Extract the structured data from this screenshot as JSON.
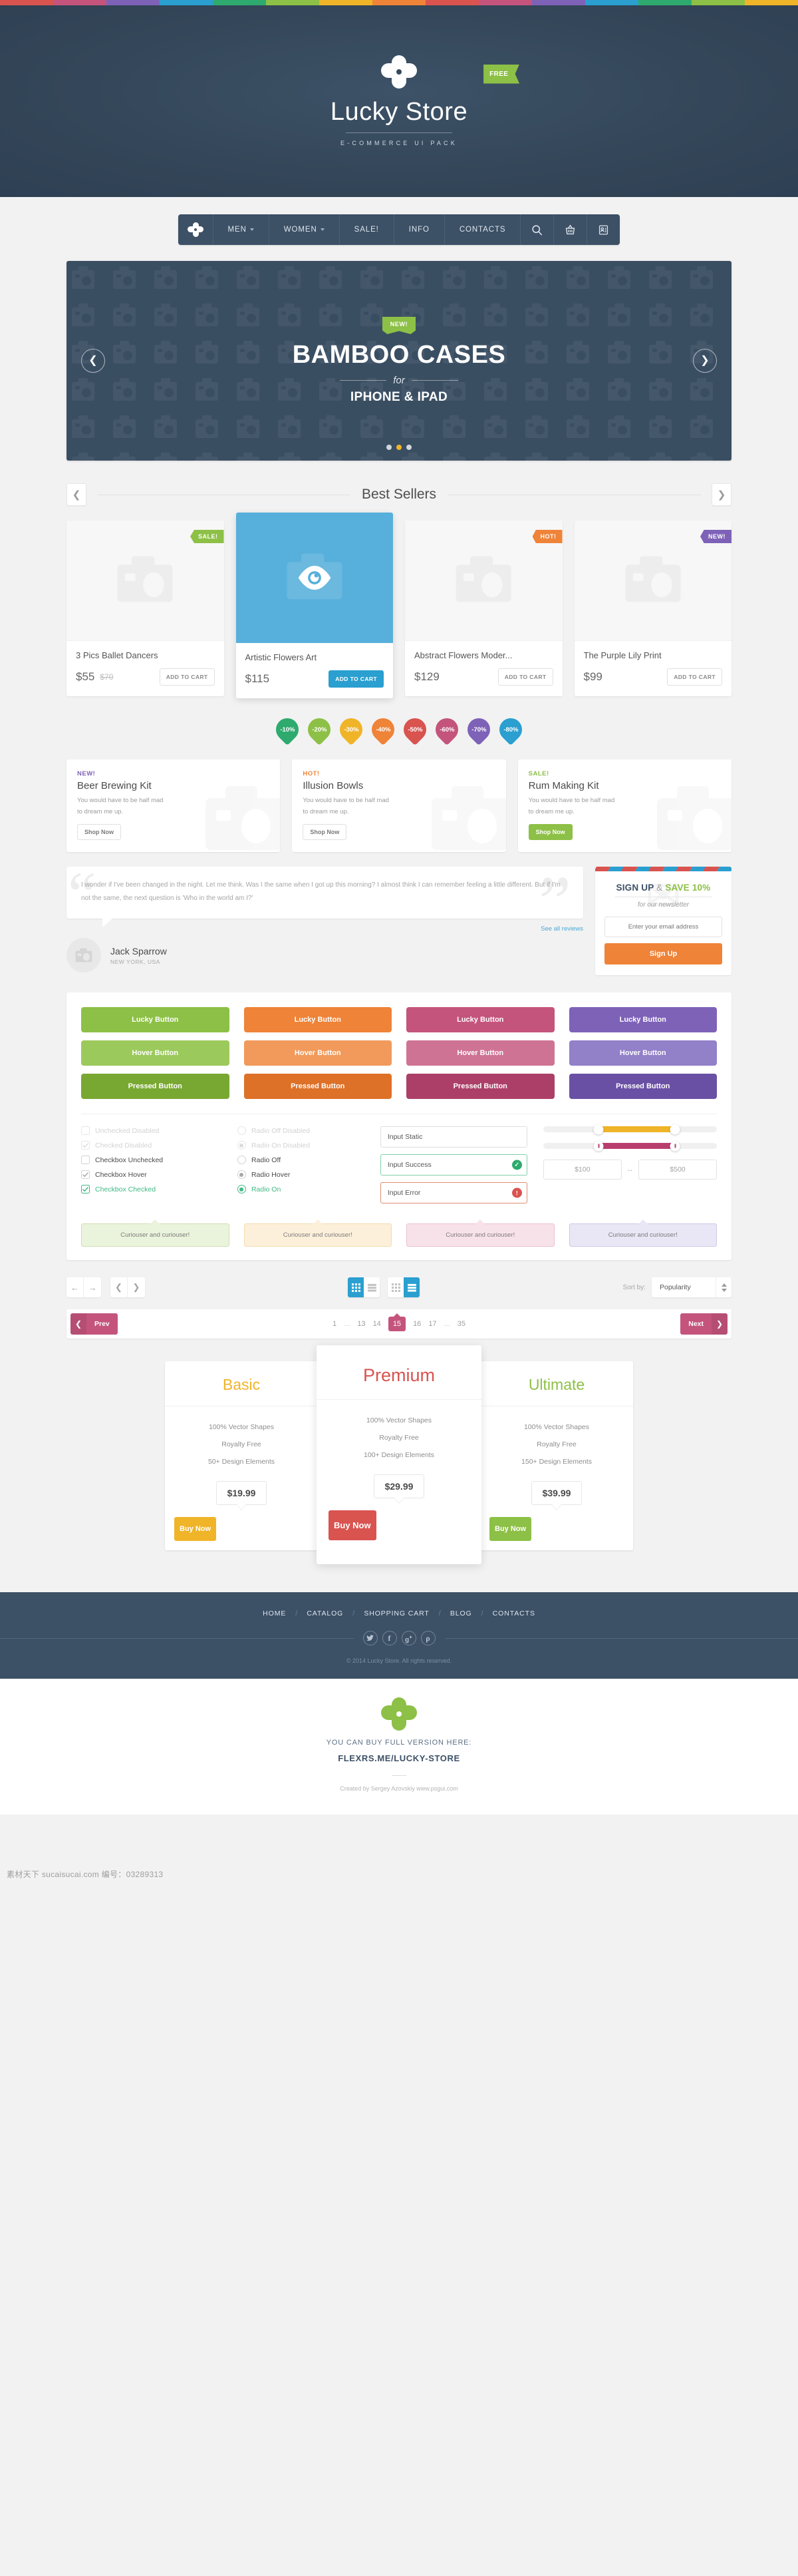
{
  "stripe_colors": [
    "#d9534f",
    "#c4547c",
    "#7e62b8",
    "#2a9fd0",
    "#2eaa6e",
    "#8dc046",
    "#f0b429",
    "#ef8338",
    "#d9534f",
    "#c4547c",
    "#7e62b8",
    "#2a9fd0",
    "#2eaa6e",
    "#8dc046",
    "#f0b429"
  ],
  "hero": {
    "logo_icon": "clover-logo-icon",
    "title": "Lucky Store",
    "subtitle": "E-COMMERCE UI PACK",
    "free_badge": "FREE"
  },
  "nav": {
    "logo_icon": "clover-logo-icon",
    "items": [
      {
        "label": "MEN",
        "has_caret": true
      },
      {
        "label": "WOMEN",
        "has_caret": true
      },
      {
        "label": "SALE!",
        "has_caret": false
      },
      {
        "label": "INFO",
        "has_caret": false
      },
      {
        "label": "CONTACTS",
        "has_caret": false
      }
    ],
    "icons": [
      "search-icon",
      "basket-icon",
      "contact-card-icon"
    ]
  },
  "slider": {
    "badge": "NEW!",
    "title": "BAMBOO CASES",
    "connector": "for",
    "subtitle": "IPHONE & IPAD",
    "prev_icon": "chevron-left-icon",
    "next_icon": "chevron-right-icon",
    "dots": 3,
    "active_dot": 2,
    "active_dot_color": "#f0b429"
  },
  "best_sellers": {
    "title": "Best Sellers",
    "prev_icon": "chevron-left-icon",
    "next_icon": "chevron-right-icon",
    "products": [
      {
        "name": "3 Pics Ballet Dancers",
        "price": "$55",
        "old_price": "$70",
        "cta": "ADD TO CART",
        "ribbon": "SALE!",
        "ribbon_color": "#8dc046",
        "featured": false
      },
      {
        "name": "Artistic Flowers Art",
        "price": "$115",
        "old_price": "",
        "cta": "ADD TO CART",
        "ribbon": "",
        "ribbon_color": "",
        "featured": true
      },
      {
        "name": "Abstract Flowers Moder...",
        "price": "$129",
        "old_price": "",
        "cta": "ADD TO CART",
        "ribbon": "HOT!",
        "ribbon_color": "#ef8338",
        "featured": false
      },
      {
        "name": "The Purple Lily Print",
        "price": "$99",
        "old_price": "",
        "cta": "ADD TO CART",
        "ribbon": "NEW!",
        "ribbon_color": "#7e62b8",
        "featured": false
      }
    ]
  },
  "discount_badges": [
    {
      "label": "-10%",
      "color": "#2eaa6e"
    },
    {
      "label": "-20%",
      "color": "#8dc046"
    },
    {
      "label": "-30%",
      "color": "#f0b429"
    },
    {
      "label": "-40%",
      "color": "#ef8338"
    },
    {
      "label": "-50%",
      "color": "#d9534f"
    },
    {
      "label": "-60%",
      "color": "#c4547c"
    },
    {
      "label": "-70%",
      "color": "#7e62b8"
    },
    {
      "label": "-80%",
      "color": "#2a9fd0"
    }
  ],
  "promos": [
    {
      "tag": "NEW!",
      "tag_color": "#7e62b8",
      "title": "Beer Brewing Kit",
      "text": "You would have to be half mad to dream me up.",
      "cta": "Shop Now",
      "cta_filled": false
    },
    {
      "tag": "HOT!",
      "tag_color": "#ef8338",
      "title": "Illusion Bowls",
      "text": "You would have to be half mad to dream me up.",
      "cta": "Shop Now",
      "cta_filled": false
    },
    {
      "tag": "SALE!",
      "tag_color": "#8dc046",
      "title": "Rum Making Kit",
      "text": "You would have to be half mad to dream me up.",
      "cta": "Shop Now",
      "cta_filled": true
    }
  ],
  "testimonial": {
    "quote": "I wonder if I've been changed in the night. Let me think. Was I the same when I got up this morning? I almost think I can remember feeling a little different. But if I'm not the same, the next question is 'Who in the world am I?'",
    "see_all": "See all reviews",
    "author_name": "Jack Sparrow",
    "author_location": "NEW YORK, USA",
    "avatar_icon": "photo-placeholder-icon"
  },
  "newsletter": {
    "title_1": "SIGN UP",
    "title_amp": "&",
    "title_2": "SAVE 10%",
    "tagline": "for our newsletter",
    "input_placeholder": "Enter your email address",
    "input_value": "",
    "button": "Sign Up",
    "button_color": "#ef8338",
    "edge_colors": [
      "#d9534f",
      "#2a9fd0",
      "#d9534f",
      "#2a9fd0",
      "#d9534f",
      "#2a9fd0",
      "#d9534f",
      "#2a9fd0",
      "#d9534f",
      "#2a9fd0"
    ]
  },
  "uikit": {
    "buttons": [
      {
        "label": "Lucky Button",
        "color": "#8dc046"
      },
      {
        "label": "Lucky Button",
        "color": "#ef8338"
      },
      {
        "label": "Lucky Button",
        "color": "#c4547c"
      },
      {
        "label": "Lucky Button",
        "color": "#7e62b8"
      },
      {
        "label": "Hover Button",
        "color": "#9cc95c"
      },
      {
        "label": "Hover Button",
        "color": "#f19a5c"
      },
      {
        "label": "Hover Button",
        "color": "#cf7394"
      },
      {
        "label": "Hover Button",
        "color": "#9280c9"
      },
      {
        "label": "Pressed Button",
        "color": "#79a832"
      },
      {
        "label": "Pressed Button",
        "color": "#dd7128"
      },
      {
        "label": "Pressed Button",
        "color": "#ac3f68"
      },
      {
        "label": "Pressed Button",
        "color": "#6a50a5"
      }
    ],
    "checkboxes": [
      {
        "label": "Unchecked Disabled",
        "state": "disabled-off"
      },
      {
        "label": "Checked Disabled",
        "state": "disabled-on"
      },
      {
        "label": "Checkbox Unchecked",
        "state": "off"
      },
      {
        "label": "Checkbox Hover",
        "state": "hover-on"
      },
      {
        "label": "Checkbox Checked",
        "state": "checked"
      }
    ],
    "radios": [
      {
        "label": "Radio Off Disabled",
        "state": "disabled-off"
      },
      {
        "label": "Radio On Disabled",
        "state": "disabled-on"
      },
      {
        "label": "Radio Off",
        "state": "off"
      },
      {
        "label": "Radio Hover",
        "state": "hover-on"
      },
      {
        "label": "Radio On",
        "state": "checked"
      }
    ],
    "inputs": [
      {
        "value": "Input Static",
        "state": "static",
        "icon": ""
      },
      {
        "value": "Input Success",
        "state": "success",
        "icon": "check-circle-icon"
      },
      {
        "value": "Input Error",
        "state": "error",
        "icon": "alert-circle-icon"
      }
    ],
    "sliders": [
      {
        "fill_color": "#f0b429",
        "start_pct": 32,
        "end_pct": 76,
        "style": "plain"
      },
      {
        "fill_color": "#b93d6e",
        "start_pct": 32,
        "end_pct": 76,
        "style": "lined"
      }
    ],
    "price_range": {
      "min": "$100",
      "max": "$500",
      "separator": "↔"
    },
    "tooltips": [
      {
        "label": "Curiouser and curiouser!",
        "bg": "#eaf3db",
        "border": "#cfe0b4"
      },
      {
        "label": "Curiouser and curiouser!",
        "bg": "#fdf0da",
        "border": "#f3dcae"
      },
      {
        "label": "Curiouser and curiouser!",
        "bg": "#f8e2ea",
        "border": "#ebc1ce"
      },
      {
        "label": "Curiouser and curiouser!",
        "bg": "#e9e6f5",
        "border": "#cfc8e6"
      }
    ]
  },
  "toolbar": {
    "nav_icons": [
      "arrow-left-icon",
      "arrow-right-icon"
    ],
    "chev_icons": [
      "chevron-left-icon",
      "chevron-right-icon"
    ],
    "view_sets": [
      {
        "icons": [
          "grid-view-icon",
          "list-view-icon"
        ],
        "active_index": 0
      },
      {
        "icons": [
          "grid-view-icon",
          "list-view-icon"
        ],
        "active_index": 1
      }
    ],
    "sort_label": "Sort by:",
    "sort_value": "Popularity",
    "accent": "#2a9fd0"
  },
  "pagination": {
    "prev": "Prev",
    "next": "Next",
    "prev_icon": "chevron-left-icon",
    "next_icon": "chevron-right-icon",
    "pages": [
      "1",
      "…",
      "13",
      "14",
      "15",
      "16",
      "17",
      "…",
      "35"
    ],
    "current": "15",
    "accent": "#c4547c"
  },
  "pricing": [
    {
      "name": "Basic",
      "name_color": "#f0b429",
      "features": [
        "100% Vector Shapes",
        "Royalty Free",
        "50+ Design Elements"
      ],
      "price": "$19.99",
      "cta": "Buy Now",
      "cta_color": "#f0b429",
      "featured": false
    },
    {
      "name": "Premium",
      "name_color": "#d9534f",
      "features": [
        "100% Vector Shapes",
        "Royalty Free",
        "100+ Design Elements"
      ],
      "price": "$29.99",
      "cta": "Buy Now",
      "cta_color": "#d9534f",
      "featured": true
    },
    {
      "name": "Ultimate",
      "name_color": "#8dc046",
      "features": [
        "100% Vector Shapes",
        "Royalty Free",
        "150+ Design Elements"
      ],
      "price": "$39.99",
      "cta": "Buy Now",
      "cta_color": "#8dc046",
      "featured": false
    }
  ],
  "footer": {
    "links": [
      "HOME",
      "CATALOG",
      "SHOPPING CART",
      "BLOG",
      "CONTACTS"
    ],
    "social": [
      "twitter-icon",
      "facebook-icon",
      "google-plus-icon",
      "pinterest-icon"
    ],
    "copyright": "© 2014 Lucky Store. All rights reserved."
  },
  "credits": {
    "logo_icon": "clover-logo-icon",
    "line1": "YOU CAN BUY FULL VERSION HERE:",
    "line2": "FLEXRS.ME/LUCKY-STORE",
    "by": "Created by Sergey Azovskiy  www.psgui.com"
  },
  "watermark": {
    "text": "素材天下 sucaisucai.com  编号：03289313"
  }
}
